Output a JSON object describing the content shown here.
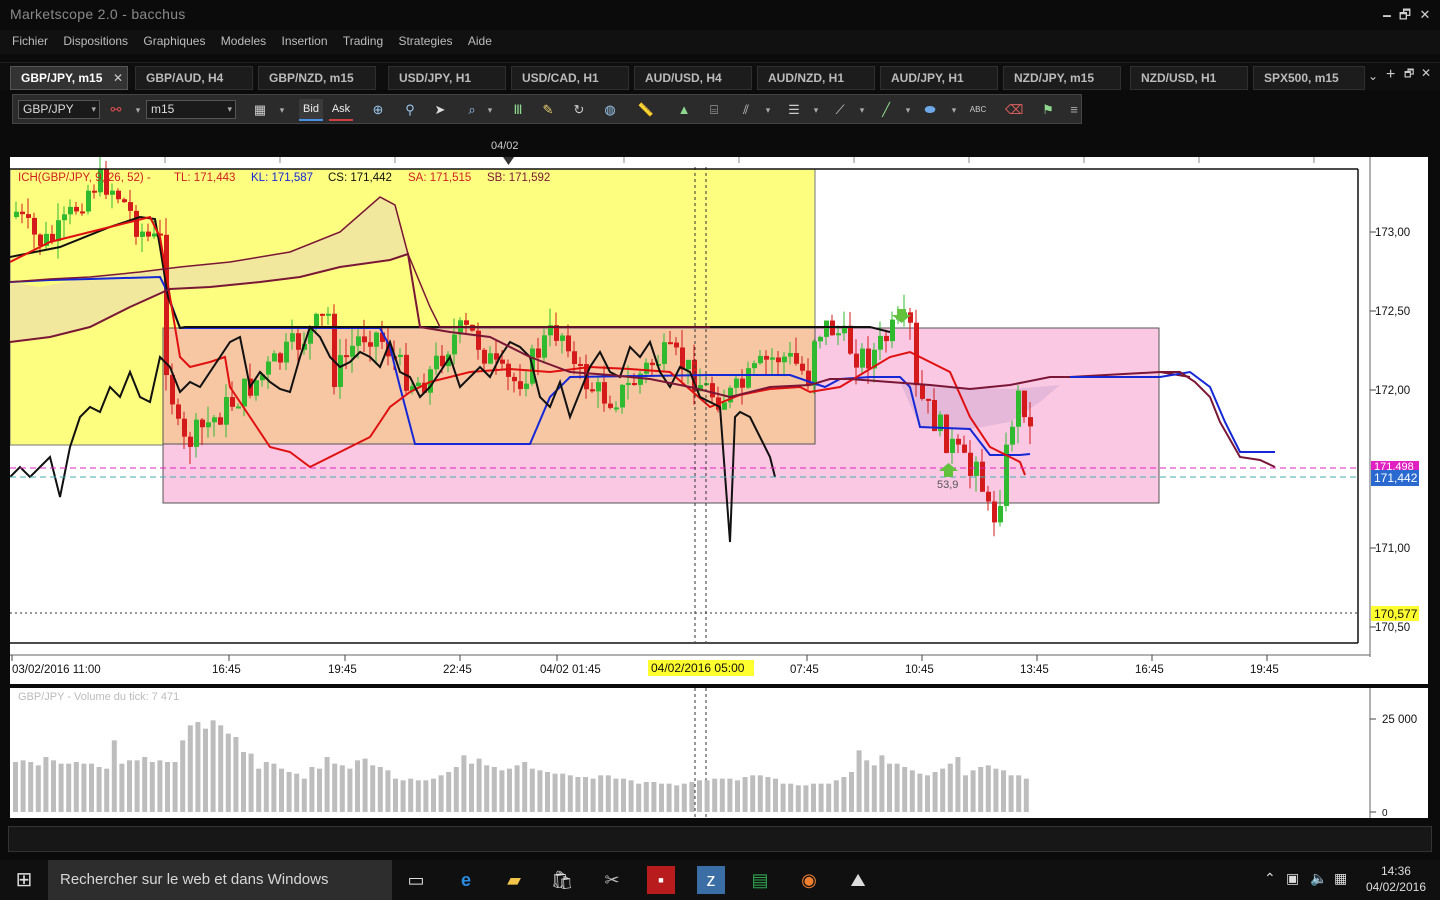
{
  "app": {
    "title": "Marketscope 2.0 - bacchus",
    "minimize": "🗕",
    "maximize": "🗗",
    "close": "✕"
  },
  "menu": [
    "Fichier",
    "Dispositions",
    "Graphiques",
    "Modeles",
    "Insertion",
    "Trading",
    "Strategies",
    "Aide"
  ],
  "tabs": [
    {
      "label": "GBP/JPY, m15",
      "active": true
    },
    {
      "label": "GBP/AUD, H4"
    },
    {
      "label": "GBP/NZD, m15"
    },
    {
      "label": "USD/JPY, H1"
    },
    {
      "label": "USD/CAD, H1"
    },
    {
      "label": "AUD/USD, H4"
    },
    {
      "label": "AUD/NZD, H1"
    },
    {
      "label": "AUD/JPY, H1"
    },
    {
      "label": "NZD/JPY, m15"
    },
    {
      "label": "NZD/USD, H1"
    },
    {
      "label": "SPX500, m15"
    }
  ],
  "tab_close": "✕",
  "tab_overflow": "⌄",
  "tab_add": "+",
  "toolbar": {
    "symbol": "GBP/JPY",
    "timeframe": "m15",
    "bid": "Bid",
    "ask": "Ask",
    "dropdown_arrow": "▾",
    "icons": [
      "candle-type-icon",
      "crosshair-icon",
      "zoom-icon",
      "pointer-icon",
      "zoom-area-icon",
      "indicator-icon",
      "properties-icon",
      "refresh-icon",
      "globe-icon",
      "ruler-icon",
      "picture-icon",
      "signal-icon",
      "lines-icon",
      "channel-icon",
      "fibonacci-icon",
      "pencil-icon",
      "shape-icon",
      "text-icon",
      "eraser-icon",
      "alert-icon",
      "more-icon"
    ]
  },
  "chart": {
    "indicator_label": "ICH(GBP/JPY, 9, 26, 52) -",
    "tl": "TL: 171,443",
    "kl": "KL: 171,587",
    "cs": "CS: 171,442",
    "sa": "SA: 171,515",
    "sb": "SB: 171,592",
    "top_date_marker": "04/02",
    "y_ticks": [
      "173,00",
      "172,50",
      "172,00",
      "171,00",
      "170,50"
    ],
    "price_tag_magenta": "171,498",
    "price_tag_current": "171,442",
    "price_tag_level": "170,577",
    "annotation_value": "53,9",
    "x_ticks": [
      "03/02/2016 11:00",
      "16:45",
      "19:45",
      "22:45",
      "04/02 01:45",
      "07:45",
      "10:45",
      "13:45",
      "16:45",
      "19:45"
    ],
    "x_cursor_label": "04/02/2016 05:00",
    "colors": {
      "yellow_zone": "#fdfd80",
      "orange_zone": "#f7c7a4",
      "pink_zone": "#fbc8e4",
      "candle_up": "#2fba2f",
      "candle_down": "#d41a1a",
      "tenkan": "#e01010",
      "kijun": "#1428d6",
      "chikou": "#111111",
      "senkou": "#7a1636"
    }
  },
  "volume": {
    "label": "GBP/JPY - Volume du tick: 7 471",
    "y_ticks": [
      "25 000",
      "0"
    ],
    "values": [
      30,
      31,
      30,
      28,
      33,
      31,
      29,
      29,
      30,
      29,
      29,
      27,
      26,
      43,
      29,
      31,
      31,
      33,
      30,
      31,
      30,
      30,
      43,
      52,
      54,
      50,
      55,
      52,
      47,
      45,
      36,
      35,
      26,
      30,
      29,
      26,
      24,
      23,
      20,
      27,
      26,
      33,
      29,
      28,
      26,
      31,
      32,
      28,
      27,
      25,
      20,
      19,
      20,
      19,
      19,
      20,
      22,
      24,
      27,
      34,
      29,
      32,
      28,
      27,
      25,
      26,
      28,
      30,
      26,
      25,
      24,
      23,
      23,
      22,
      21,
      21,
      20,
      22,
      22,
      20,
      20,
      19,
      17,
      18,
      18,
      17,
      17,
      16,
      17,
      18,
      19,
      19,
      20,
      20,
      20,
      19,
      21,
      22,
      22,
      21,
      20,
      17,
      17,
      16,
      16,
      17,
      17,
      17,
      19,
      21,
      24,
      37,
      31,
      28,
      34,
      29,
      29,
      27,
      25,
      23,
      22,
      24,
      26,
      29,
      33,
      22,
      25,
      27,
      28,
      26,
      25,
      22,
      22,
      20
    ]
  },
  "taskbar": {
    "search": "Rechercher sur le web et dans Windows",
    "time": "14:36",
    "date": "04/02/2016"
  }
}
